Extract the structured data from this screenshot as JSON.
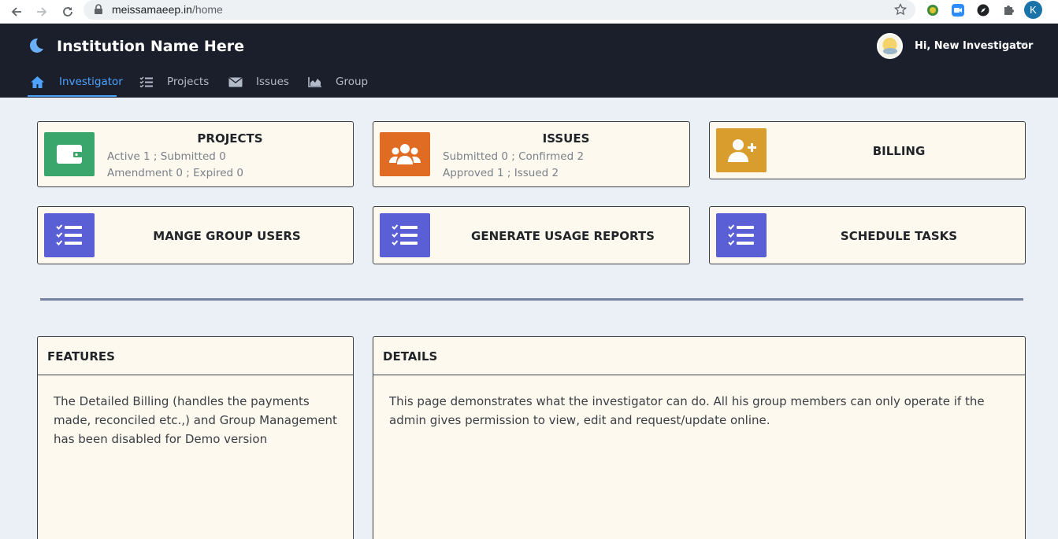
{
  "browser": {
    "url_host": "meissamaeep.in",
    "url_path": "/home",
    "profile_initial": "K"
  },
  "header": {
    "institution_name": "Institution Name Here",
    "user_greeting": "Hi, New Investigator",
    "tabs": [
      {
        "label": "Investigator",
        "icon": "home-icon",
        "active": true
      },
      {
        "label": "Projects",
        "icon": "tasks-icon",
        "active": false
      },
      {
        "label": "Issues",
        "icon": "envelope-icon",
        "active": false
      },
      {
        "label": "Group",
        "icon": "area-chart-icon",
        "active": false
      }
    ]
  },
  "cards": {
    "projects": {
      "title": "PROJECTS",
      "line1": "Active 1 ; Submitted 0",
      "line2": "Amendment 0 ; Expired 0",
      "color": "#3aa66b",
      "icon": "wallet-icon"
    },
    "issues": {
      "title": "ISSUES",
      "line1": "Submitted 0 ; Confirmed 2",
      "line2": "Approved 1 ; Issued 2",
      "color": "#e06b22",
      "icon": "users-icon"
    },
    "billing": {
      "title": "BILLING",
      "color": "#d89d2d",
      "icon": "user-plus-icon"
    },
    "manage_users": {
      "title": "MANGE GROUP USERS",
      "color": "#5a5fd6",
      "icon": "tasks-icon"
    },
    "usage_reports": {
      "title": "GENERATE USAGE REPORTS",
      "color": "#5a5fd6",
      "icon": "tasks-icon"
    },
    "schedule_tasks": {
      "title": "SCHEDULE TASKS",
      "color": "#5a5fd6",
      "icon": "tasks-icon"
    }
  },
  "panels": {
    "features": {
      "title": "FEATURES",
      "body": "The Detailed Billing (handles the payments made, reconciled etc.,) and Group Management has been disabled for Demo version"
    },
    "details": {
      "title": "DETAILS",
      "body": "This page demonstrates what the investigator can do. All his group members can only operate if the admin gives permission to view, edit and request/update online."
    }
  }
}
